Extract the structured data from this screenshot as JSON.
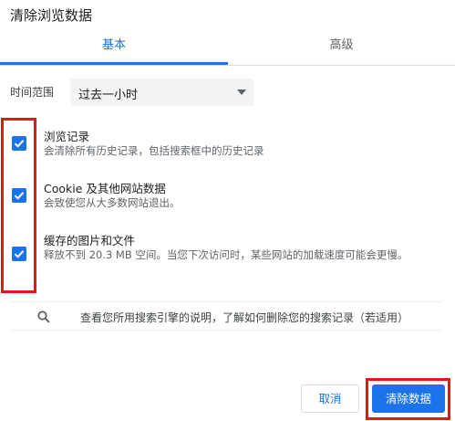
{
  "dialog": {
    "title": "清除浏览数据"
  },
  "tabs": [
    {
      "label": "基本"
    },
    {
      "label": "高级"
    }
  ],
  "time_range": {
    "label": "时间范围",
    "selected": "过去一小时"
  },
  "options": [
    {
      "title": "浏览记录",
      "description": "会清除所有历史记录，包括搜索框中的历史记录",
      "checked": true
    },
    {
      "title": "Cookie 及其他网站数据",
      "description": "会致使您从大多数网站退出。",
      "checked": true
    },
    {
      "title": "缓存的图片和文件",
      "description": "释放不到 20.3 MB 空间。当您下次访问时，某些网站的加载速度可能会更慢。",
      "checked": true
    }
  ],
  "search_info": {
    "text": "查看您所用搜索引擎的说明，了解如何删除您的搜索记录（若适用）"
  },
  "buttons": {
    "cancel": "取消",
    "clear": "清除数据"
  },
  "colors": {
    "accent": "#1a73e8",
    "highlight": "#e8141a"
  }
}
